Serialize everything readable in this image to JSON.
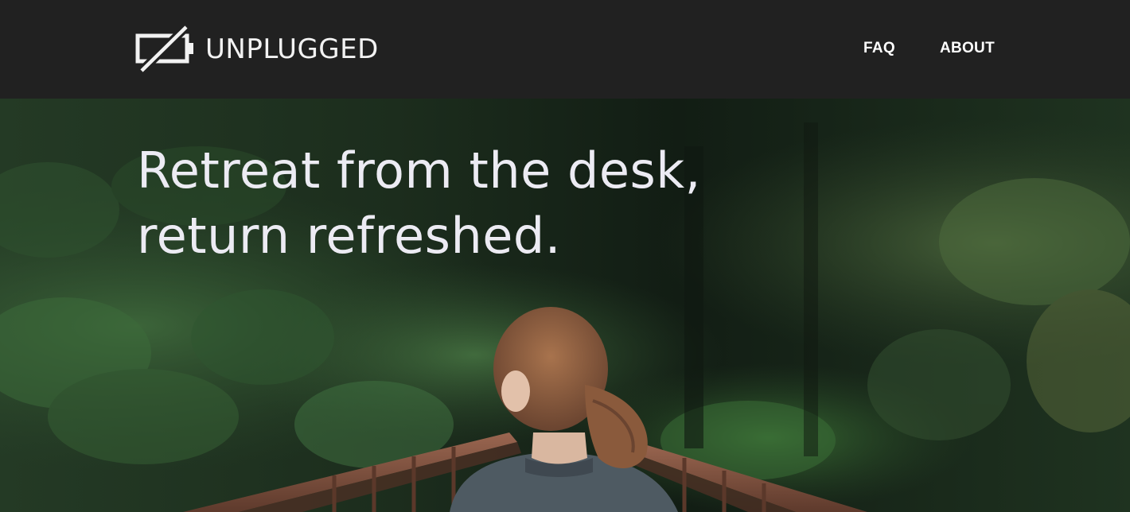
{
  "header": {
    "brand": "UNPLUGGED",
    "logo_icon": "battery-crossed-icon",
    "nav": [
      {
        "label": "FAQ"
      },
      {
        "label": "ABOUT"
      }
    ]
  },
  "hero": {
    "title_line1": "Retreat from the desk,",
    "title_line2": "return refreshed.",
    "image": "forest-bridge-woman-photo"
  },
  "colors": {
    "header_bg": "#212121",
    "text_light": "#ecebf3",
    "forest_dark": "#1d2a1e",
    "bridge_rust": "#7a4e3a"
  }
}
